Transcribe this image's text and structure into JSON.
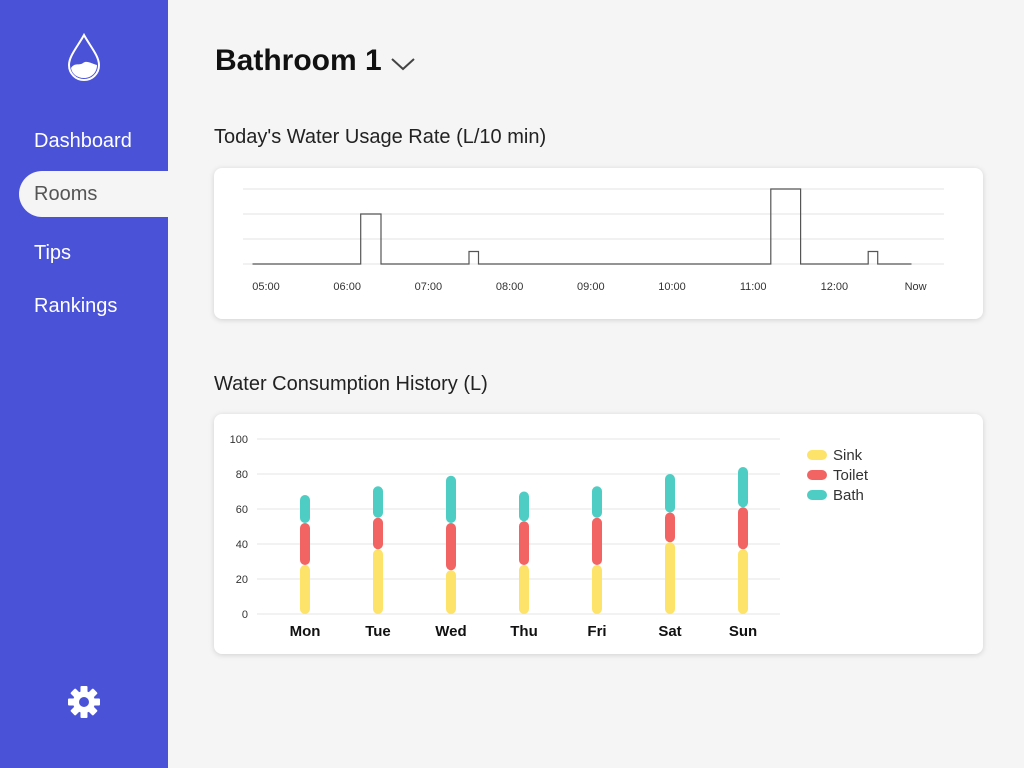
{
  "nav": {
    "items": [
      {
        "label": "Dashboard",
        "active": false
      },
      {
        "label": "Rooms",
        "active": true
      },
      {
        "label": "Tips",
        "active": false
      },
      {
        "label": "Rankings",
        "active": false
      }
    ]
  },
  "icons": {
    "logo": "water-drop-icon",
    "settings": "gear-icon",
    "dropdown": "chevron-down-icon"
  },
  "colors": {
    "sidebar": "#4a52d8",
    "sink": "#fde36a",
    "toilet": "#f26464",
    "bath": "#4ecdc4"
  },
  "room": {
    "title": "Bathroom 1"
  },
  "usage_section": {
    "title": "Today's Water Usage Rate (L/10 min)"
  },
  "history_section": {
    "title": "Water Consumption History (L)"
  },
  "chart_data": [
    {
      "type": "line",
      "title": "Today's Water Usage Rate (L/10 min)",
      "x_ticks": [
        "05:00",
        "06:00",
        "07:00",
        "08:00",
        "09:00",
        "10:00",
        "11:00",
        "12:00",
        "Now"
      ],
      "step": true,
      "grid": true,
      "ylim": [
        0,
        3
      ],
      "points": [
        {
          "t": "04:50",
          "v": 0
        },
        {
          "t": "06:10",
          "v": 0
        },
        {
          "t": "06:10",
          "v": 2
        },
        {
          "t": "06:25",
          "v": 2
        },
        {
          "t": "06:25",
          "v": 0
        },
        {
          "t": "07:30",
          "v": 0
        },
        {
          "t": "07:30",
          "v": 0.5
        },
        {
          "t": "07:37",
          "v": 0.5
        },
        {
          "t": "07:37",
          "v": 0
        },
        {
          "t": "11:13",
          "v": 0
        },
        {
          "t": "11:13",
          "v": 3
        },
        {
          "t": "11:35",
          "v": 3
        },
        {
          "t": "11:35",
          "v": 0
        },
        {
          "t": "12:25",
          "v": 0
        },
        {
          "t": "12:25",
          "v": 0.5
        },
        {
          "t": "12:32",
          "v": 0.5
        },
        {
          "t": "12:32",
          "v": 0
        },
        {
          "t": "12:57",
          "v": 0
        }
      ]
    },
    {
      "type": "bar",
      "stacked": true,
      "title": "Water Consumption History (L)",
      "categories": [
        "Mon",
        "Tue",
        "Wed",
        "Thu",
        "Fri",
        "Sat",
        "Sun"
      ],
      "y_ticks": [
        "0",
        "20",
        "40",
        "60",
        "80",
        "100"
      ],
      "ylim": [
        0,
        100
      ],
      "grid": true,
      "legend_position": "top-right",
      "series": [
        {
          "name": "Sink",
          "values": [
            28,
            37,
            25,
            28,
            28,
            41,
            37
          ]
        },
        {
          "name": "Toilet",
          "values": [
            24,
            18,
            27,
            25,
            27,
            17,
            24
          ]
        },
        {
          "name": "Bath",
          "values": [
            16,
            18,
            27,
            17,
            18,
            22,
            23
          ]
        }
      ]
    }
  ]
}
